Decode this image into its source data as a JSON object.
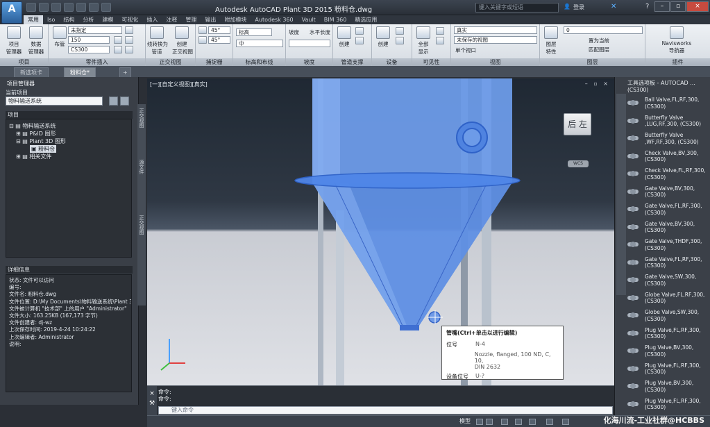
{
  "title": "Autodesk AutoCAD Plant 3D 2015     粉料仓.dwg",
  "search_placeholder": "键入关键字或短语",
  "login": "登录",
  "ribbon_tabs": [
    "常用",
    "Iso",
    "结构",
    "分析",
    "建模",
    "可视化",
    "插入",
    "注释",
    "管理",
    "输出",
    "附加模块",
    "Autodesk 360",
    "Vault",
    "BIM 360",
    "精选应用"
  ],
  "ribbon": {
    "btn_project_mgr": "项目\n管理器",
    "btn_data_mgr": "数据\n管理器",
    "btn_layout": "布管",
    "spec_value": "未指定",
    "size_value": "150",
    "cs_value": "CS300",
    "btn_line_to_pipe": "线转换为\n管道",
    "btn_ortho": "创建\n正交视图",
    "angle1": "45°",
    "angle2": "45°",
    "elev_label": "标高",
    "mid_label": "中",
    "slope_label": "坡度",
    "water_label": "水平长度",
    "btn_create1": "创建",
    "btn_create2": "创建",
    "btn_show_all": "全部\n显示",
    "vs_value": "真实",
    "view_value": "未保存的视图",
    "viewport_value": "单个视口",
    "btn_layer_props": "图层\n特性",
    "layer_value": "0",
    "set_current": "置为当前",
    "match_layer": "匹配图层",
    "btn_navisworks": "Navisworks\n导航器",
    "groups": [
      "项目",
      "零件插入",
      "正交视图",
      "捕捉栅",
      "标高和布线",
      "坡度",
      "管道支撑",
      "设备",
      "可见性",
      "视图",
      "图层",
      "插件"
    ]
  },
  "doc_tabs": [
    "新选项卡",
    "粉料仓*"
  ],
  "left_palette": {
    "header": "项目管理器",
    "current_project_label": "当前项目",
    "project_value": "物料输送系统",
    "tree_header": "项目",
    "tree": [
      "物料输送系统",
      "P&ID 图形",
      "Plant 3D 图形",
      "粉料仓",
      "相关文件"
    ],
    "detail_header": "详细信息",
    "details": [
      "状态: 文件可以访问",
      "编号:",
      "文件名: 粉料仓.dwg",
      "文件位置: D:\\My Documents\\物料输送系统\\Plant 3",
      "文件被计算机 \"技术部\" 上的用户 \"Administrator\"",
      "文件大小: 163.25KB (167,173 字节)",
      "文件创建者: dj-wz",
      "上次保存时间: 2019-4-24  10:24:22",
      "上次编辑者: Administrator",
      "说明:"
    ],
    "vertical_tabs": [
      "正交视图",
      "源文件",
      "正交视图"
    ]
  },
  "viewport": {
    "label": "[一][自定义视图][真实]",
    "controls": "– ▫ ×",
    "viewcube_text": "后 左",
    "wcs": "WCS"
  },
  "tooltip": {
    "title": "管嘴(Ctrl+单击以进行编辑)",
    "rows": [
      {
        "k": "位号",
        "v": "N-4"
      },
      {
        "k": "",
        "v": "Nozzle, flanged, 100 ND, C, 10,\nDIN 2632"
      },
      {
        "k": "设备位号",
        "v": "U-?"
      }
    ]
  },
  "command": {
    "history": [
      "命令:",
      "命令:"
    ],
    "placeholder": "键入命令"
  },
  "status": {
    "model": "模型"
  },
  "right_palette": {
    "header": "工具选项板 - AUTOCAD ...",
    "top_cut": "(CS300)",
    "items": [
      "Ball Valve,FL,RF,300,\n(CS300)",
      "Butterfly Valve\n,LUG,RF,300, (CS300)",
      "Butterfly Valve\n,WF,RF,300, (CS300)",
      "Check Valve,BV,300,\n(CS300)",
      "Check Valve,FL,RF,300,\n(CS300)",
      "Gate Valve,BV,300,\n(CS300)",
      "Gate Valve,FL,RF,300,\n(CS300)",
      "Gate Valve,BV,300,\n(CS300)",
      "Gate Valve,THDF,300,\n(CS300)",
      "Gate Valve,FL,RF,300,\n(CS300)",
      "Gate Valve,SW,300,\n(CS300)",
      "Globe Valve,FL,RF,300,\n(CS300)",
      "Globe Valve,SW,300,\n(CS300)",
      "Plug Valve,FL,RF,300,\n(CS300)",
      "Plug Valve,BV,300,\n(CS300)",
      "Plug Valve,FL,RF,300,\n(CS300)",
      "Plug Valve,BV,300,\n(CS300)",
      "Plug Valve,FL,RF,300,\n(CS300)"
    ]
  },
  "watermark": "化海川流-工业社群@HCBBS"
}
